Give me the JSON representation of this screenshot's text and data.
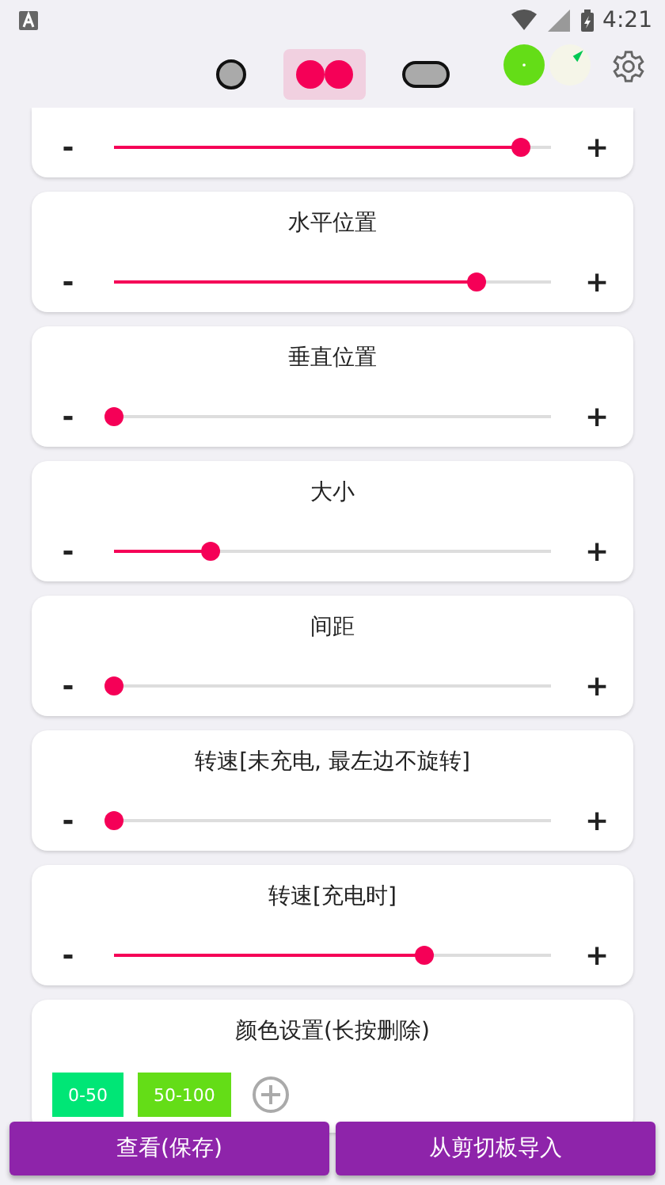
{
  "status_bar": {
    "time": "4:21"
  },
  "shape_tabs": [
    {
      "kind": "single",
      "selected": false
    },
    {
      "kind": "double",
      "selected": true
    },
    {
      "kind": "pill",
      "selected": false
    }
  ],
  "sliders": [
    {
      "minus": "-",
      "plus": "+",
      "level": 0.93
    },
    {
      "title": "水平位置",
      "minus": "-",
      "plus": "+",
      "level": 0.83
    },
    {
      "title": "垂直位置",
      "minus": "-",
      "plus": "+",
      "level": 0
    },
    {
      "title": "大小",
      "minus": "-",
      "plus": "+",
      "level": 0.22
    },
    {
      "title": "间距",
      "minus": "-",
      "plus": "+",
      "level": 0
    },
    {
      "title": "转速[未充电, 最左边不旋转]",
      "minus": "-",
      "plus": "+",
      "level": 0
    },
    {
      "title": "转速[充电时]",
      "minus": "-",
      "plus": "+",
      "level": 0.71
    }
  ],
  "color_settings": {
    "title": "颜色设置(长按删除)",
    "ranges": [
      {
        "label": "0-50",
        "color": "#00e676"
      },
      {
        "label": "50-100",
        "color": "#64dd17"
      }
    ]
  },
  "buttons": [
    "查看(保存)",
    "从剪切板导入"
  ]
}
